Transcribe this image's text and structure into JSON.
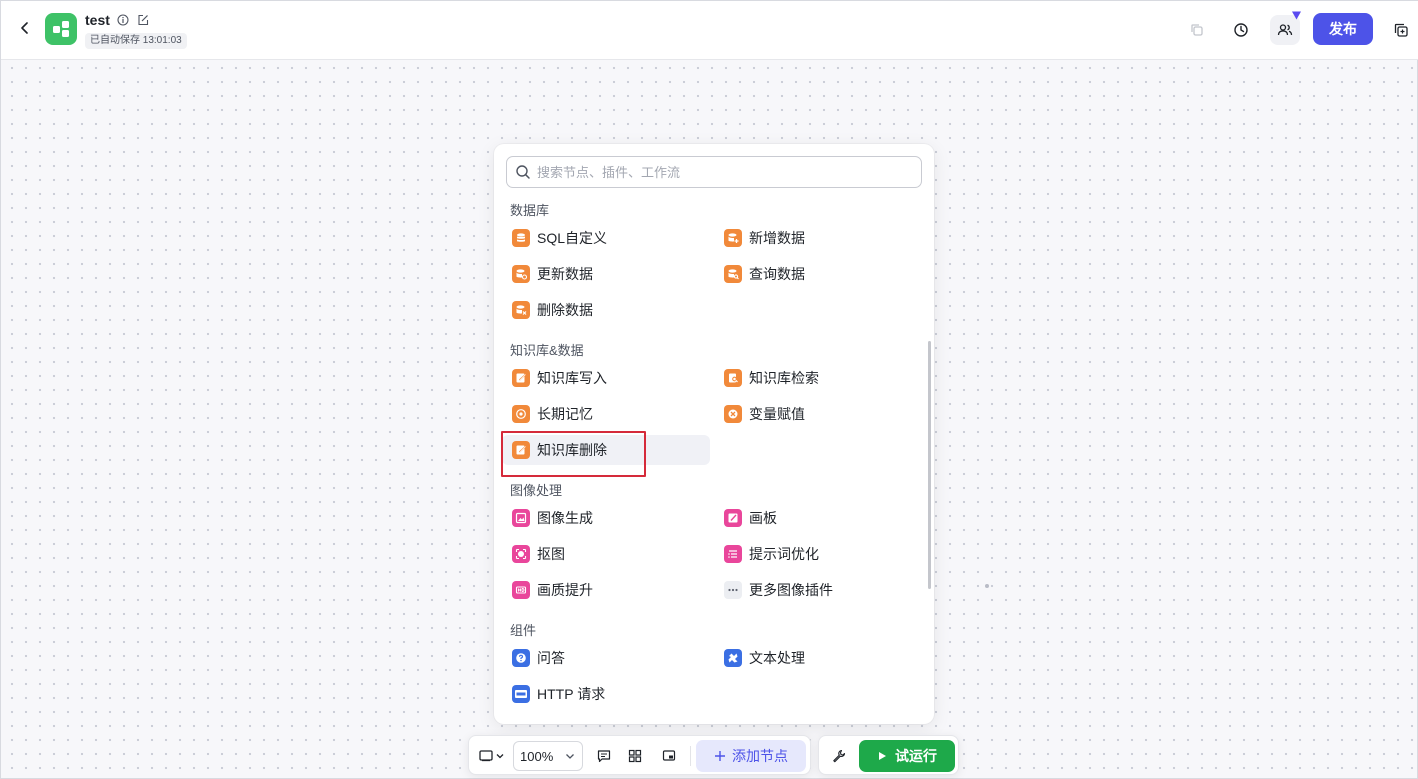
{
  "header": {
    "back_icon": "chevron-left-icon",
    "title": "test",
    "autosave": "已自动保存 13:01:03",
    "publish_label": "发布"
  },
  "panel": {
    "search_placeholder": "搜索节点、插件、工作流",
    "sections": [
      {
        "title": "数据库",
        "items": [
          {
            "label": "SQL自定义",
            "icon": "database-icon"
          },
          {
            "label": "新增数据",
            "icon": "database-add-icon"
          },
          {
            "label": "更新数据",
            "icon": "database-update-icon"
          },
          {
            "label": "查询数据",
            "icon": "database-query-icon"
          },
          {
            "label": "删除数据",
            "icon": "database-delete-icon"
          }
        ]
      },
      {
        "title": "知识库&数据",
        "items": [
          {
            "label": "知识库写入",
            "icon": "knowledge-write-icon"
          },
          {
            "label": "知识库检索",
            "icon": "knowledge-search-icon"
          },
          {
            "label": "长期记忆",
            "icon": "memory-icon"
          },
          {
            "label": "变量赋值",
            "icon": "variable-assign-icon"
          },
          {
            "label": "知识库删除",
            "icon": "knowledge-delete-icon"
          }
        ]
      },
      {
        "title": "图像处理",
        "items": [
          {
            "label": "图像生成",
            "icon": "image-generate-icon"
          },
          {
            "label": "画板",
            "icon": "canvas-icon"
          },
          {
            "label": "抠图",
            "icon": "cutout-icon"
          },
          {
            "label": "提示词优化",
            "icon": "prompt-optimize-icon"
          },
          {
            "label": "画质提升",
            "icon": "hd-enhance-icon"
          },
          {
            "label": "更多图像插件",
            "icon": "more-icon"
          }
        ]
      },
      {
        "title": "组件",
        "items": [
          {
            "label": "问答",
            "icon": "question-icon"
          },
          {
            "label": "文本处理",
            "icon": "text-process-icon"
          },
          {
            "label": "HTTP 请求",
            "icon": "http-icon"
          }
        ]
      }
    ]
  },
  "toolbar": {
    "zoom": "100%",
    "add_node_label": "添加节点",
    "run_label": "试运行"
  },
  "colors": {
    "accent": "#4d53e8",
    "run_green": "#1ea94a",
    "db_orange": "#f1893a",
    "image_pink": "#e9469b",
    "component_blue": "#3b6fe3",
    "annotation_red": "#d52a3a"
  }
}
